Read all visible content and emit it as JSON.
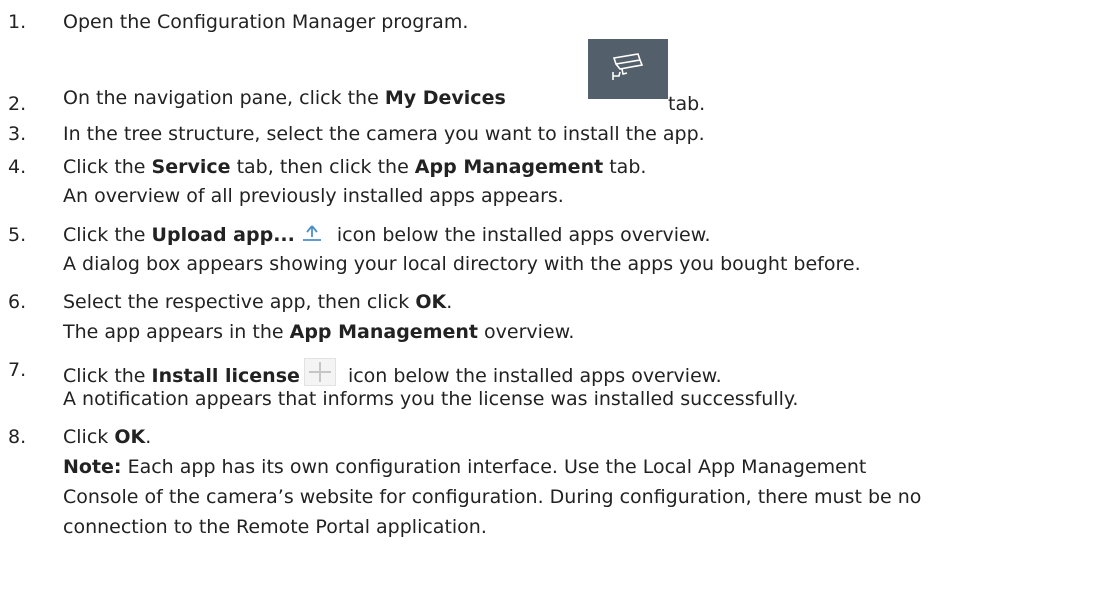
{
  "steps": [
    {
      "number": "1.",
      "parts": [
        "Open the Configuration Manager program."
      ]
    },
    {
      "number": "2.",
      "parts": [
        "On the navigation pane, click the ",
        "My Devices",
        " tab."
      ],
      "icon": "my-devices-camera-icon"
    },
    {
      "number": "3.",
      "parts": [
        "In the tree structure, select the camera you want to install the app."
      ]
    },
    {
      "number": "4.",
      "parts": [
        "Click the ",
        "Service",
        " tab, then click the ",
        "App Management",
        " tab."
      ],
      "result": "An overview of all previously installed apps appears."
    },
    {
      "number": "5.",
      "parts": [
        "Click the ",
        "Upload app...",
        " icon below the installed apps overview."
      ],
      "icon": "upload-icon",
      "result": "A dialog box appears showing your local directory with the apps you bought before."
    },
    {
      "number": "6.",
      "parts": [
        "Select the respective app, then click ",
        "OK",
        "."
      ],
      "result_parts": [
        "The app appears in the ",
        "App Management",
        " overview."
      ]
    },
    {
      "number": "7.",
      "parts": [
        "Click the ",
        "Install license",
        " icon below the installed apps overview."
      ],
      "icon": "plus-icon",
      "result": "A notification appears that informs you the license was installed successfully."
    },
    {
      "number": "8.",
      "parts": [
        "Click ",
        "OK",
        "."
      ],
      "note_label": "Note:",
      "note_lines": [
        " Each app has its own configuration interface. Use the Local App Management",
        "Console of the camera’s website for configuration. During configuration, there must be no",
        "connection to the Remote Portal application."
      ]
    }
  ],
  "colors": {
    "text": "#222222",
    "icon_bg": "#53606b",
    "upload_icon": "#4b8ec8"
  }
}
